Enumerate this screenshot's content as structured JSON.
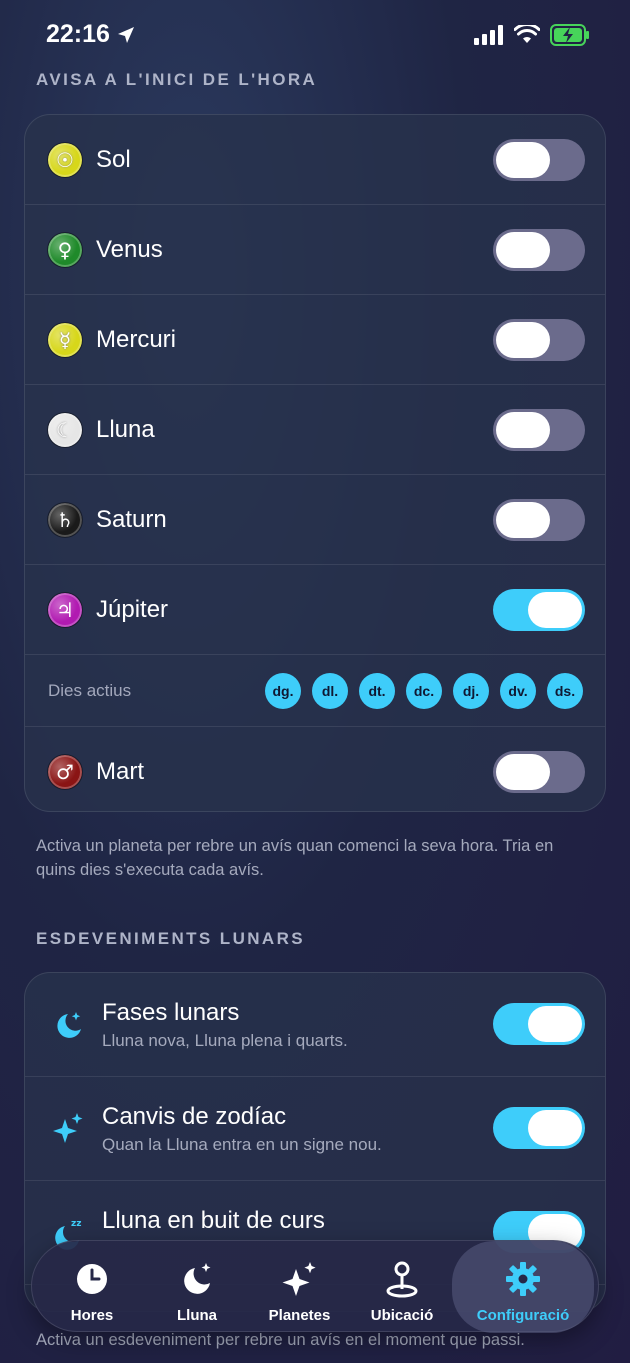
{
  "status_bar": {
    "time": "22:16"
  },
  "sections": {
    "hour_alerts": {
      "header": "AVISA A L'INICI DE L'HORA",
      "planets": [
        {
          "name": "Sol",
          "symbol": "☉",
          "color": "#d7d71a",
          "on": false
        },
        {
          "name": "Venus",
          "symbol": "♀",
          "color": "#1f8a2a",
          "on": false
        },
        {
          "name": "Mercuri",
          "symbol": "☿",
          "color": "#d7d71a",
          "on": false
        },
        {
          "name": "Lluna",
          "symbol": "☾",
          "color": "#e6e6e6",
          "on": false
        },
        {
          "name": "Saturn",
          "symbol": "♄",
          "color": "#1a1a1a",
          "on": false
        },
        {
          "name": "Júpiter",
          "symbol": "♃",
          "color": "#b11ab1",
          "on": true
        },
        {
          "name": "Mart",
          "symbol": "♂",
          "color": "#8a1414",
          "on": false
        }
      ],
      "days_label": "Dies actius",
      "days": [
        "dg.",
        "dl.",
        "dt.",
        "dc.",
        "dj.",
        "dv.",
        "ds."
      ],
      "footnote": "Activa un planeta per rebre un avís quan comenci la seva hora. Tria en quins dies s'executa cada avís."
    },
    "lunar_events": {
      "header": "ESDEVENIMENTS LUNARS",
      "items": [
        {
          "title": "Fases lunars",
          "subtitle": "Lluna nova, Lluna plena i quarts.",
          "icon": "moon-stars-icon",
          "on": true
        },
        {
          "title": "Canvis de zodíac",
          "subtitle": "Quan la Lluna entra en un signe nou.",
          "icon": "sparkles-icon",
          "on": true
        },
        {
          "title": "Lluna en buit de curs",
          "subtitle": "",
          "icon": "moon-zzz-icon",
          "on": true
        }
      ],
      "footnote": "Activa un esdeveniment per rebre un avís en el moment que passi."
    }
  },
  "tab_bar": {
    "tabs": [
      {
        "label": "Hores",
        "icon": "clock-icon"
      },
      {
        "label": "Lluna",
        "icon": "moon-stars-icon"
      },
      {
        "label": "Planetes",
        "icon": "sparkles-icon"
      },
      {
        "label": "Ubicació",
        "icon": "location-pin-icon"
      },
      {
        "label": "Configuració",
        "icon": "gear-icon"
      }
    ],
    "active_index": 4
  },
  "colors": {
    "accent": "#3ecdfa",
    "toggle_off": "#6b6b8c"
  }
}
